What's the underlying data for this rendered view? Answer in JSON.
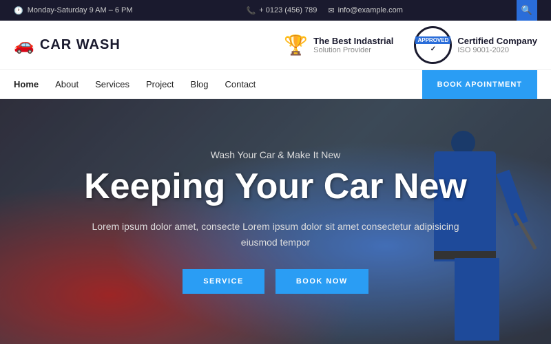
{
  "topbar": {
    "hours": "Monday-Saturday 9 AM – 6 PM",
    "phone": "+ 0123 (456) 789",
    "email": "info@example.com",
    "search_icon": "search"
  },
  "header": {
    "logo_text": "CAR WASH",
    "logo_icon": "🚗",
    "badge1": {
      "icon": "trophy",
      "title": "The Best Indastrial",
      "subtitle": "Solution Provider"
    },
    "badge2": {
      "stamp_approved": "APPROVED",
      "title": "Certified Company",
      "subtitle": "ISO 9001-2020"
    }
  },
  "nav": {
    "links": [
      {
        "label": "Home",
        "active": true
      },
      {
        "label": "About",
        "active": false
      },
      {
        "label": "Services",
        "active": false
      },
      {
        "label": "Project",
        "active": false
      },
      {
        "label": "Blog",
        "active": false
      },
      {
        "label": "Contact",
        "active": false
      }
    ],
    "book_button": "BOOK APOINTMENT"
  },
  "hero": {
    "subtitle": "Wash Your Car & Make It New",
    "title": "Keeping Your Car New",
    "description": "Lorem ipsum dolor amet, consecte Lorem ipsum dolor sit amet consectetur adipisicing eiusmod tempor",
    "btn_service": "SERVICE",
    "btn_book": "BOOK NOW"
  }
}
